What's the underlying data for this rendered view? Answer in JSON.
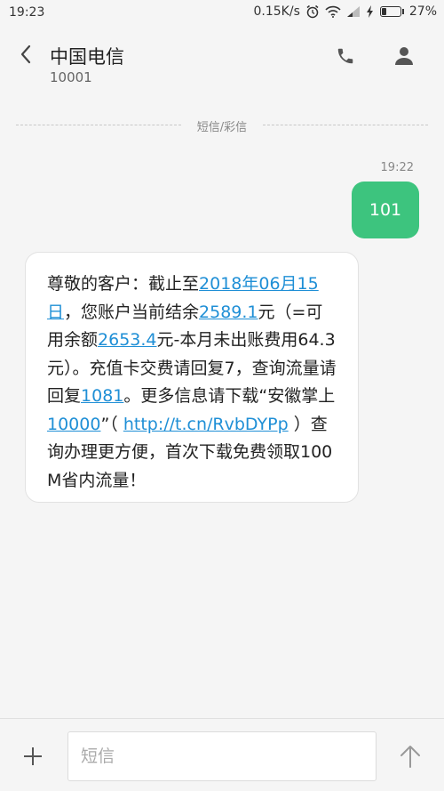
{
  "status_bar": {
    "time": "19:23",
    "network_speed": "0.15K/s",
    "battery_percent": "27%",
    "battery_level": 0.27,
    "icons": [
      "alarm-icon",
      "wifi-icon",
      "signal-icon",
      "charging-icon",
      "battery-icon"
    ]
  },
  "header": {
    "contact_name": "中国电信",
    "contact_number": "10001",
    "icons": [
      "back-icon",
      "phone-icon",
      "person-icon"
    ]
  },
  "conversation": {
    "channel_label": "短信/彩信",
    "sent": {
      "time": "19:22",
      "text": "101"
    },
    "received": {
      "segments": [
        {
          "text": "尊敬的客户：截止至",
          "link": false
        },
        {
          "text": "2018年06月15日",
          "link": true
        },
        {
          "text": "，您账户当前结余",
          "link": false
        },
        {
          "text": "2589.1",
          "link": true
        },
        {
          "text": "元（=可用余额",
          "link": false
        },
        {
          "text": "2653.4",
          "link": true
        },
        {
          "text": "元-本月未出账费用64.3元）。充值卡交费请回复7，查询流量请回复",
          "link": false
        },
        {
          "text": "1081",
          "link": true
        },
        {
          "text": "。更多信息请下载“安徽掌上",
          "link": false
        },
        {
          "text": "10000",
          "link": true
        },
        {
          "text": "”（ ",
          "link": false
        },
        {
          "text": "http://t.cn/RvbDYPp",
          "link": true
        },
        {
          "text": " ）查询办理更方便，首次下载免费领取100M省内流量！",
          "link": false
        }
      ]
    }
  },
  "composer": {
    "placeholder": "短信",
    "icons": [
      "plus-icon",
      "send-arrow-icon"
    ]
  },
  "colors": {
    "sent_bubble": "#3dc47e",
    "link": "#1f8fd6",
    "background": "#f5f5f5"
  }
}
